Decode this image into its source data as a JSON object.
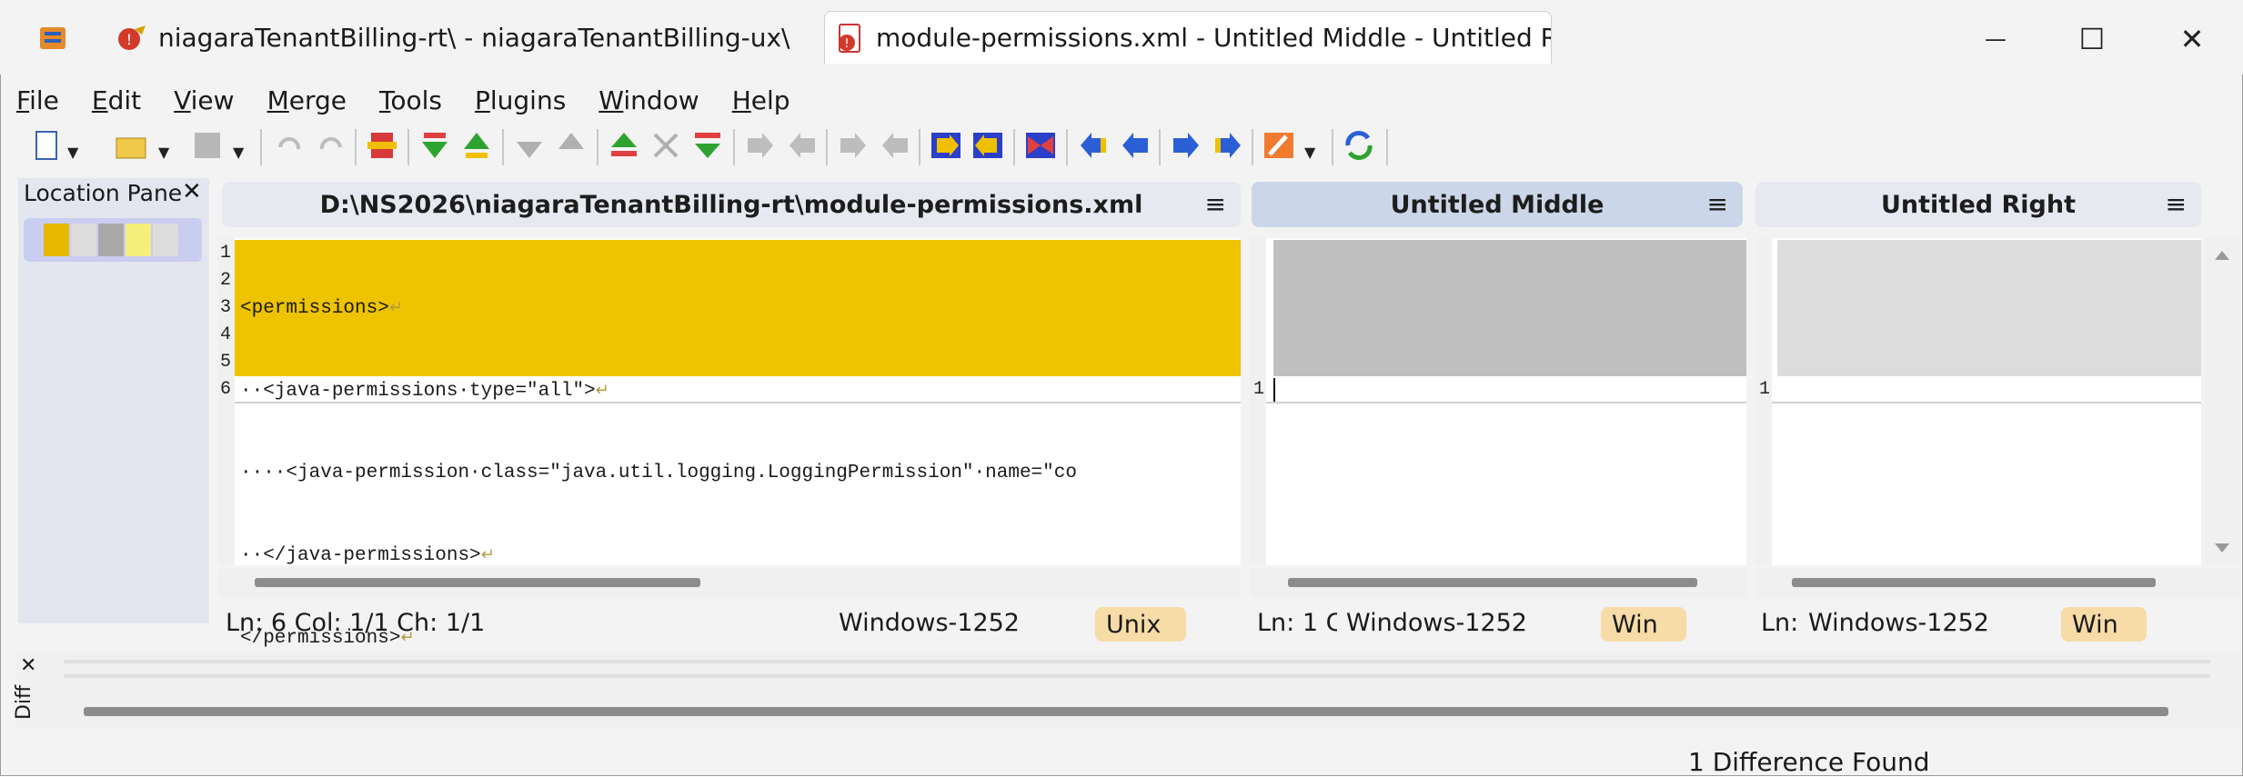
{
  "tabs": [
    {
      "label": "niagaraTenantBilling-rt\\ - niagaraTenantBilling-ux\\ - n..."
    },
    {
      "label": "module-permissions.xml - Untitled Middle - Untitled Right"
    }
  ],
  "window_controls": {
    "minimize": "—",
    "maximize": "☐",
    "close": "✕"
  },
  "menu": [
    {
      "underline": "F",
      "rest": "ile"
    },
    {
      "underline": "E",
      "rest": "dit"
    },
    {
      "underline": "V",
      "rest": "iew"
    },
    {
      "underline": "M",
      "rest": "erge"
    },
    {
      "underline": "T",
      "rest": "ools"
    },
    {
      "underline": "P",
      "rest": "lugins"
    },
    {
      "underline": "W",
      "rest": "indow"
    },
    {
      "underline": "H",
      "rest": "elp"
    }
  ],
  "location_pane": {
    "title": "Location Pane",
    "close": "✕"
  },
  "panes": {
    "left": {
      "header": "D:\\NS2026\\niagaraTenantBilling-rt\\module-permissions.xml",
      "hamburger": "≡",
      "line_numbers": [
        "1",
        "2",
        "3",
        "4",
        "5",
        "6"
      ],
      "lines": [
        "<permissions>",
        "··<java-permissions·type=\"all\">",
        "····<java-permission·class=\"java.util.logging.LoggingPermission\"·name=\"co",
        "··</java-permissions>",
        "</permissions>",
        ""
      ],
      "status_pos": "Ln: 6  Col: 1/1  Ch: 1/1",
      "status_encoding": "Windows-1252",
      "status_eol": "Unix"
    },
    "middle": {
      "header": "Untitled Middle",
      "hamburger": "≡",
      "line_number": "1",
      "status_pos": "Ln: 1  C",
      "status_encoding": "Windows-1252",
      "status_eol": "Win"
    },
    "right": {
      "header": "Untitled Right",
      "hamburger": "≡",
      "line_number": "1",
      "status_pos": "Ln:",
      "status_encoding": "Windows-1252",
      "status_eol": "Win"
    }
  },
  "diff_panel": {
    "label": "Diff",
    "close": "✕"
  },
  "statusbar": {
    "text": "1 Difference Found"
  },
  "colors": {
    "highlight": "#eec300",
    "eol_badge": "#f7dca8",
    "header_active": "#cbd6e8"
  }
}
